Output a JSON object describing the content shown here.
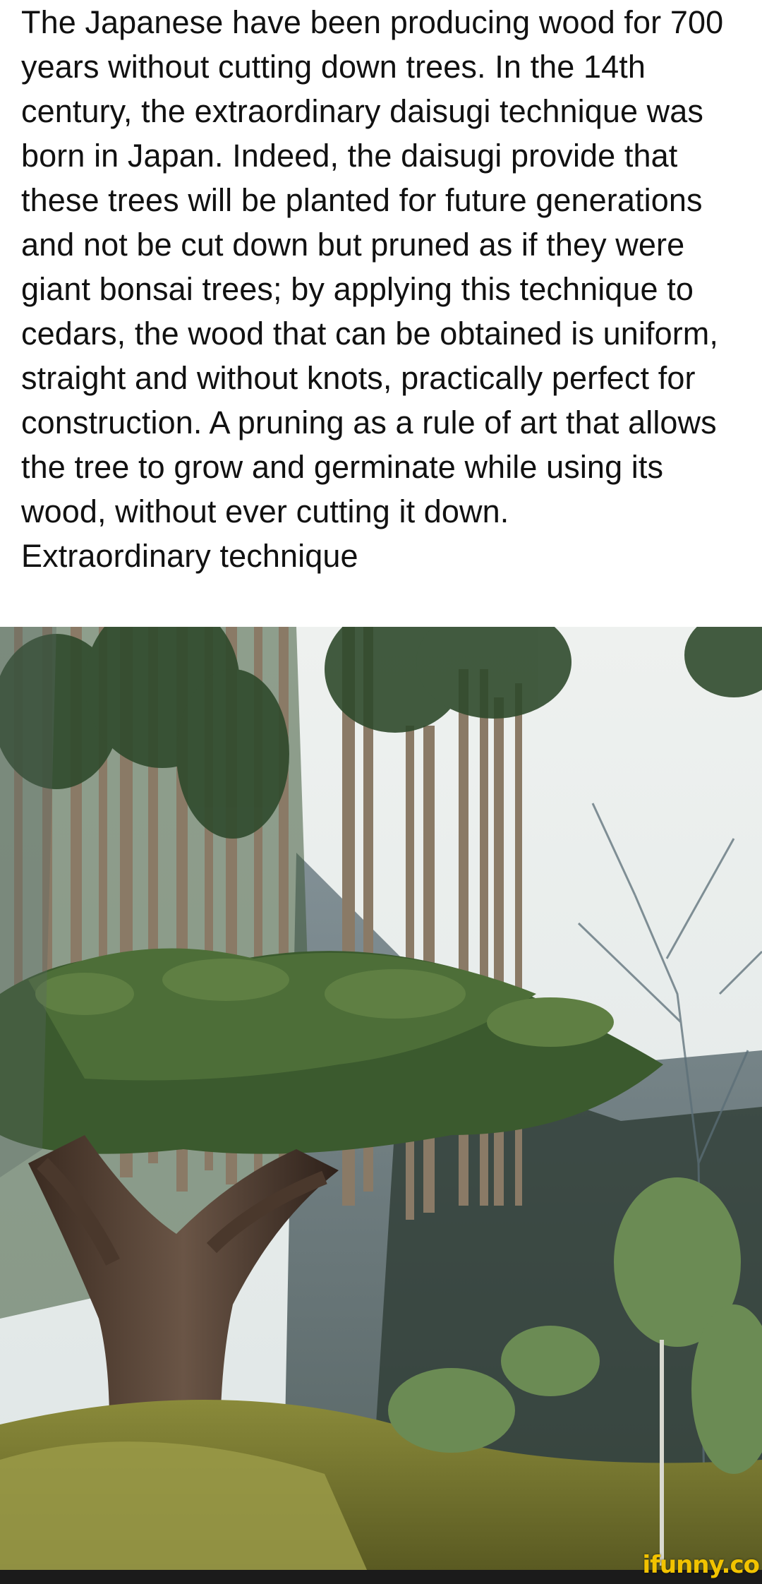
{
  "post": {
    "text_paragraphs": [
      "The Japanese have been producing wood for 700 years without cutting down trees. In the 14th century, the extraordinary daisugi technique was born in Japan. Indeed, the daisugi provide that these trees will be planted for future generations and not be cut down but pruned as if they were giant bonsai trees; by applying this technique to cedars, the wood that can be obtained is uniform, straight and without knots, practically perfect for construction. A pruning as a rule of art that allows the tree to grow and germinate while using its wood, without ever cutting it down.",
      "Extraordinary technique"
    ]
  },
  "photo": {
    "subject": "daisugi-cedar-tree"
  },
  "footer": {
    "watermark": "ifunny.co",
    "watermark_color": "#f2c300",
    "bar_color": "#1b1b1b"
  }
}
